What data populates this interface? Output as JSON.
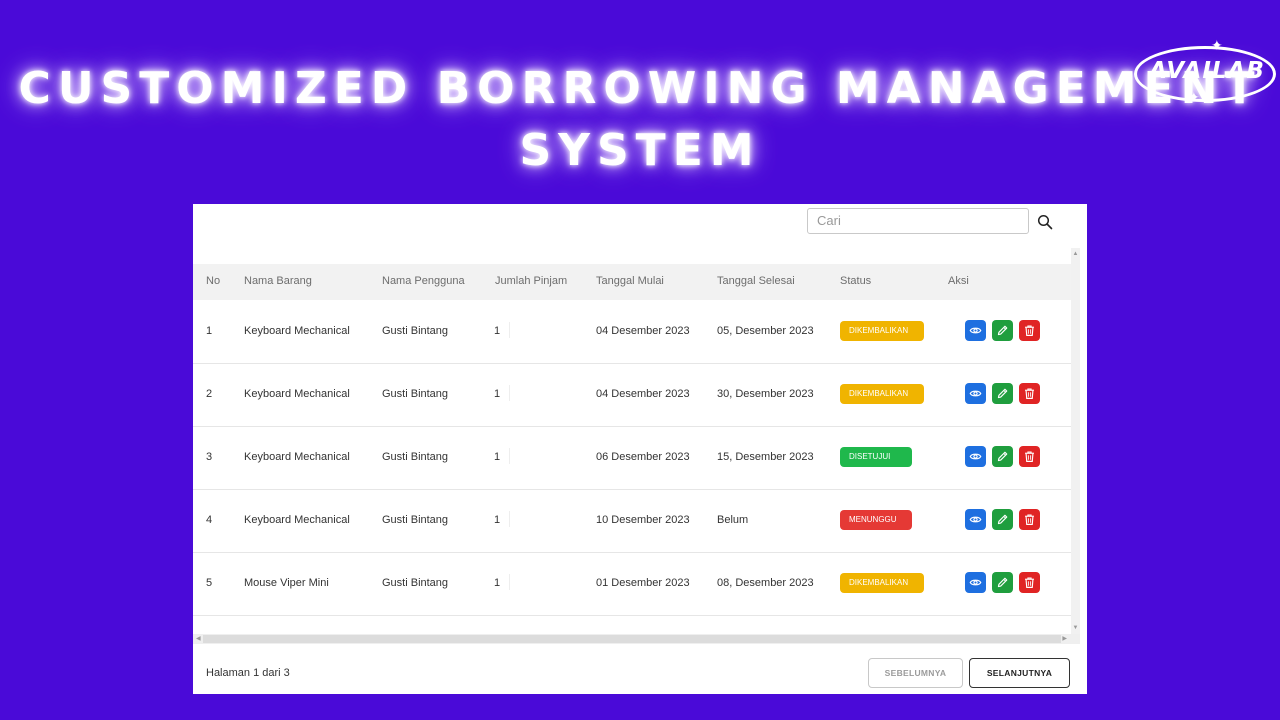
{
  "header": {
    "title_line1": "CUSTOMIZED BORROWING MANAGEMENT",
    "title_line2": "SYSTEM"
  },
  "logo": {
    "text": "AVAILAB"
  },
  "search": {
    "placeholder": "Cari",
    "icon": "search-icon"
  },
  "table": {
    "columns": [
      "No",
      "Nama Barang",
      "Nama Pengguna",
      "Jumlah Pinjam",
      "Tanggal Mulai",
      "Tanggal Selesai",
      "Status",
      "Aksi"
    ],
    "rows": [
      {
        "no": "1",
        "item": "Keyboard Mechanical",
        "user": "Gusti Bintang",
        "qty": "1",
        "start": "04 Desember 2023",
        "end": "05, Desember 2023",
        "status": "DIKEMBALIKAN",
        "status_color": "#f0b400"
      },
      {
        "no": "2",
        "item": "Keyboard Mechanical",
        "user": "Gusti Bintang",
        "qty": "1",
        "start": "04 Desember 2023",
        "end": "30, Desember 2023",
        "status": "DIKEMBALIKAN",
        "status_color": "#f0b400"
      },
      {
        "no": "3",
        "item": "Keyboard Mechanical",
        "user": "Gusti Bintang",
        "qty": "1",
        "start": "06 Desember 2023",
        "end": "15, Desember 2023",
        "status": "DISETUJUI",
        "status_color": "#1fb84c"
      },
      {
        "no": "4",
        "item": "Keyboard Mechanical",
        "user": "Gusti Bintang",
        "qty": "1",
        "start": "10 Desember 2023",
        "end": "Belum",
        "status": "MENUNGGU",
        "status_color": "#e53935"
      },
      {
        "no": "5",
        "item": "Mouse Viper Mini",
        "user": "Gusti Bintang",
        "qty": "1",
        "start": "01 Desember 2023",
        "end": "08, Desember 2023",
        "status": "DIKEMBALIKAN",
        "status_color": "#f0b400"
      }
    ],
    "action_icons": [
      "eye-icon",
      "pencil-icon",
      "trash-icon"
    ],
    "action_colors": {
      "view": "#1e6fe0",
      "edit": "#1f9e3e",
      "delete": "#e02424"
    }
  },
  "pagination": {
    "page_text": "Halaman 1 dari 3",
    "prev_label": "SEBELUMNYA",
    "next_label": "SELANJUTNYA"
  },
  "colors": {
    "background": "#4a0ad8",
    "card": "#ffffff"
  }
}
